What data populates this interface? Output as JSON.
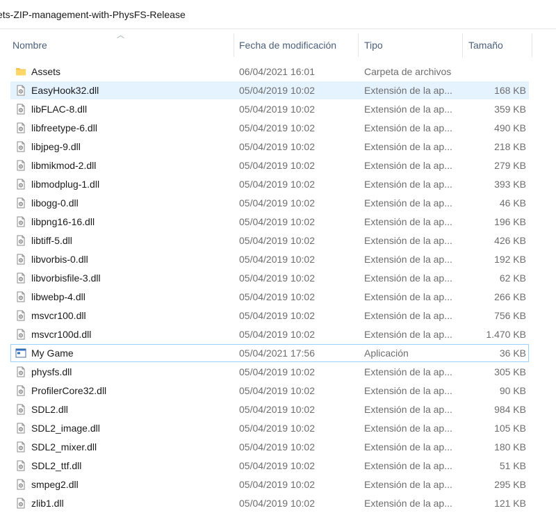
{
  "address": {
    "path_text": "ets-ZIP-management-with-PhysFS-Release"
  },
  "columns": {
    "name": "Nombre",
    "date": "Fecha de modificación",
    "type": "Tipo",
    "size": "Tamaño"
  },
  "colors": {
    "selection_bg": "#e5f3ff",
    "focus_border": "#99d1ff",
    "folder": "#f3c24f",
    "header_text": "#4c607a"
  },
  "files": [
    {
      "name": "Assets",
      "date": "06/04/2021 16:01",
      "type": "Carpeta de archivos",
      "size": "",
      "icon": "folder-icon"
    },
    {
      "name": "EasyHook32.dll",
      "date": "05/04/2019 10:02",
      "type": "Extensión de la ap...",
      "size": "168 KB",
      "icon": "dll-file-icon",
      "selected": true
    },
    {
      "name": "libFLAC-8.dll",
      "date": "05/04/2019 10:02",
      "type": "Extensión de la ap...",
      "size": "359 KB",
      "icon": "dll-file-icon"
    },
    {
      "name": "libfreetype-6.dll",
      "date": "05/04/2019 10:02",
      "type": "Extensión de la ap...",
      "size": "490 KB",
      "icon": "dll-file-icon"
    },
    {
      "name": "libjpeg-9.dll",
      "date": "05/04/2019 10:02",
      "type": "Extensión de la ap...",
      "size": "218 KB",
      "icon": "dll-file-icon"
    },
    {
      "name": "libmikmod-2.dll",
      "date": "05/04/2019 10:02",
      "type": "Extensión de la ap...",
      "size": "279 KB",
      "icon": "dll-file-icon"
    },
    {
      "name": "libmodplug-1.dll",
      "date": "05/04/2019 10:02",
      "type": "Extensión de la ap...",
      "size": "393 KB",
      "icon": "dll-file-icon"
    },
    {
      "name": "libogg-0.dll",
      "date": "05/04/2019 10:02",
      "type": "Extensión de la ap...",
      "size": "46 KB",
      "icon": "dll-file-icon"
    },
    {
      "name": "libpng16-16.dll",
      "date": "05/04/2019 10:02",
      "type": "Extensión de la ap...",
      "size": "196 KB",
      "icon": "dll-file-icon"
    },
    {
      "name": "libtiff-5.dll",
      "date": "05/04/2019 10:02",
      "type": "Extensión de la ap...",
      "size": "426 KB",
      "icon": "dll-file-icon"
    },
    {
      "name": "libvorbis-0.dll",
      "date": "05/04/2019 10:02",
      "type": "Extensión de la ap...",
      "size": "192 KB",
      "icon": "dll-file-icon"
    },
    {
      "name": "libvorbisfile-3.dll",
      "date": "05/04/2019 10:02",
      "type": "Extensión de la ap...",
      "size": "62 KB",
      "icon": "dll-file-icon"
    },
    {
      "name": "libwebp-4.dll",
      "date": "05/04/2019 10:02",
      "type": "Extensión de la ap...",
      "size": "266 KB",
      "icon": "dll-file-icon"
    },
    {
      "name": "msvcr100.dll",
      "date": "05/04/2019 10:02",
      "type": "Extensión de la ap...",
      "size": "756 KB",
      "icon": "dll-file-icon"
    },
    {
      "name": "msvcr100d.dll",
      "date": "05/04/2019 10:02",
      "type": "Extensión de la ap...",
      "size": "1.470 KB",
      "icon": "dll-file-icon"
    },
    {
      "name": "My Game",
      "date": "05/04/2021 17:56",
      "type": "Aplicación",
      "size": "36 KB",
      "icon": "application-icon",
      "focused": true
    },
    {
      "name": "physfs.dll",
      "date": "05/04/2019 10:02",
      "type": "Extensión de la ap...",
      "size": "305 KB",
      "icon": "dll-file-icon"
    },
    {
      "name": "ProfilerCore32.dll",
      "date": "05/04/2019 10:02",
      "type": "Extensión de la ap...",
      "size": "90 KB",
      "icon": "dll-file-icon"
    },
    {
      "name": "SDL2.dll",
      "date": "05/04/2019 10:02",
      "type": "Extensión de la ap...",
      "size": "984 KB",
      "icon": "dll-file-icon"
    },
    {
      "name": "SDL2_image.dll",
      "date": "05/04/2019 10:02",
      "type": "Extensión de la ap...",
      "size": "105 KB",
      "icon": "dll-file-icon"
    },
    {
      "name": "SDL2_mixer.dll",
      "date": "05/04/2019 10:02",
      "type": "Extensión de la ap...",
      "size": "180 KB",
      "icon": "dll-file-icon"
    },
    {
      "name": "SDL2_ttf.dll",
      "date": "05/04/2019 10:02",
      "type": "Extensión de la ap...",
      "size": "51 KB",
      "icon": "dll-file-icon"
    },
    {
      "name": "smpeg2.dll",
      "date": "05/04/2019 10:02",
      "type": "Extensión de la ap...",
      "size": "295 KB",
      "icon": "dll-file-icon"
    },
    {
      "name": "zlib1.dll",
      "date": "05/04/2019 10:02",
      "type": "Extensión de la ap...",
      "size": "121 KB",
      "icon": "dll-file-icon"
    }
  ]
}
